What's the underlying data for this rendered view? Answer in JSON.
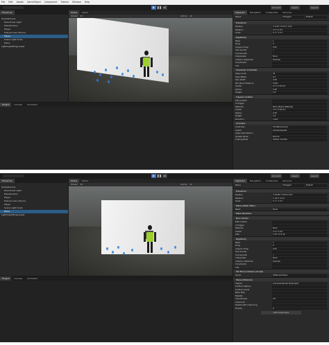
{
  "menu": [
    "File",
    "Edit",
    "Assets",
    "GameObject",
    "Component",
    "Tutorial",
    "Window",
    "Help"
  ],
  "toolbar": {
    "account": "Account",
    "layers": "Layers",
    "layout": "Layout"
  },
  "hierarchy": {
    "tab": "Hierarchy",
    "items": [
      "SampleScene",
      "Directional Light",
      "PlaneSurface",
      "Player",
      "Post-process Volume",
      "Player",
      "Scene Light Scale",
      "Plane",
      "LightingSettings.asset"
    ]
  },
  "scene_tabs": [
    "Scene",
    "Game"
  ],
  "scene_tools": [
    "Shaded",
    "2D",
    "Gizmos",
    "All"
  ],
  "bottom_tabs": [
    "Project",
    "Console",
    "Animation"
  ],
  "inspector1": {
    "tabs": [
      "Inspector",
      "Navigation",
      "Collaborate",
      "Services"
    ],
    "object_name": "Player",
    "tag": "Untagged",
    "layer": "Default",
    "components": [
      {
        "name": "Transform",
        "rows": [
          [
            "Position",
            "X 2.64  Y 0.07  Z -3.22"
          ],
          [
            "Rotation",
            "X 0  Y 0  Z 0"
          ],
          [
            "Scale",
            "X 1  Y 1  Z 1"
          ]
        ]
      },
      {
        "name": "Rigidbody",
        "rows": [
          [
            "Mass",
            "1"
          ],
          [
            "Drag",
            "0"
          ],
          [
            "Angular Drag",
            "0.05"
          ],
          [
            "Use Gravity",
            "✓"
          ],
          [
            "Is Kinematic",
            ""
          ],
          [
            "Interpolate",
            "None"
          ],
          [
            "Collision Detection",
            "Discrete"
          ],
          [
            "Constraints",
            ""
          ],
          [
            "Info",
            ""
          ]
        ]
      },
      {
        "name": "Character Controller",
        "rows": [
          [
            "Slope Limit",
            "45"
          ],
          [
            "Step Offset",
            "0.3"
          ],
          [
            "Skin Width",
            "0.08"
          ],
          [
            "Min Move Distance",
            "0.001"
          ],
          [
            "Center",
            "X 0  Y 0.93  Z 0"
          ],
          [
            "Radius",
            "0.28"
          ],
          [
            "Height",
            "1.8"
          ]
        ]
      },
      {
        "name": "Capsule Collider",
        "rows": [
          [
            "Edit Collider",
            ""
          ],
          [
            "Is Trigger",
            ""
          ],
          [
            "Material",
            "None (Physic Material)"
          ],
          [
            "Center",
            "X 0  Y 0.93  Z 0"
          ],
          [
            "Radius",
            "0.28"
          ],
          [
            "Height",
            "1.8"
          ],
          [
            "Direction",
            "Y-Axis"
          ]
        ]
      },
      {
        "name": "Animator",
        "rows": [
          [
            "Controller",
            "ThirdPersonAnim"
          ],
          [
            "Avatar",
            "ArmatureAvatar"
          ],
          [
            "Apply Root Motion",
            ""
          ],
          [
            "Update Mode",
            "Normal"
          ],
          [
            "Culling Mode",
            "Always Animate"
          ]
        ]
      }
    ]
  },
  "inspector2": {
    "tabs": [
      "Inspector",
      "Navigation",
      "Collaborate",
      "Services"
    ],
    "object_name": "Plane",
    "tag": "Untagged",
    "layer": "Default",
    "components": [
      {
        "name": "Transform",
        "rows": [
          [
            "Position",
            "X 28.88  Y 0.63  Z 4.55"
          ],
          [
            "Rotation",
            "X -90  Y 0  Z 0"
          ],
          [
            "Scale",
            "X 1  Y 1  Z 1"
          ]
        ]
      },
      {
        "name": "Plane (Mesh Filter)",
        "rows": [
          [
            "Mesh",
            "Plane"
          ]
        ]
      },
      {
        "name": "Mesh Renderer",
        "rows": []
      },
      {
        "name": "Box Collider",
        "rows": [
          [
            "Edit Collider",
            ""
          ],
          [
            "Is Trigger",
            ""
          ],
          [
            "Material",
            "None"
          ],
          [
            "Center",
            "X 0  Y 0  Z 0"
          ],
          [
            "Size",
            "X 10  Y 0  Z 10"
          ]
        ]
      },
      {
        "name": "Rigidbody",
        "rows": [
          [
            "Mass",
            "1"
          ],
          [
            "Drag",
            "0"
          ],
          [
            "Angular Drag",
            "0.05"
          ],
          [
            "Use Gravity",
            ""
          ],
          [
            "Is Kinematic",
            "✓"
          ],
          [
            "Interpolate",
            "None"
          ],
          [
            "Collision Detection",
            "Discrete"
          ],
          [
            "Constraints",
            ""
          ],
          [
            "Info",
            ""
          ]
        ]
      },
      {
        "name": "Obi Bone Collision (Script)",
        "rows": [
          [
            "Script",
            "ObiBoneCollision"
          ]
        ]
      },
      {
        "name": "Plane (Material)",
        "rows": [
          [
            "Shader",
            "Universal Render Pipeline/Lit"
          ],
          [
            "Surface Options",
            ""
          ],
          [
            "Surface Inputs",
            ""
          ],
          [
            "Base Map",
            ""
          ],
          [
            "Metallic",
            ""
          ],
          [
            "Smoothness",
            "0.5"
          ],
          [
            "Advanced",
            ""
          ],
          [
            "Enable GPU Instancing",
            ""
          ],
          [
            "Priority",
            "0"
          ]
        ]
      }
    ],
    "add_component": "Add Component"
  }
}
